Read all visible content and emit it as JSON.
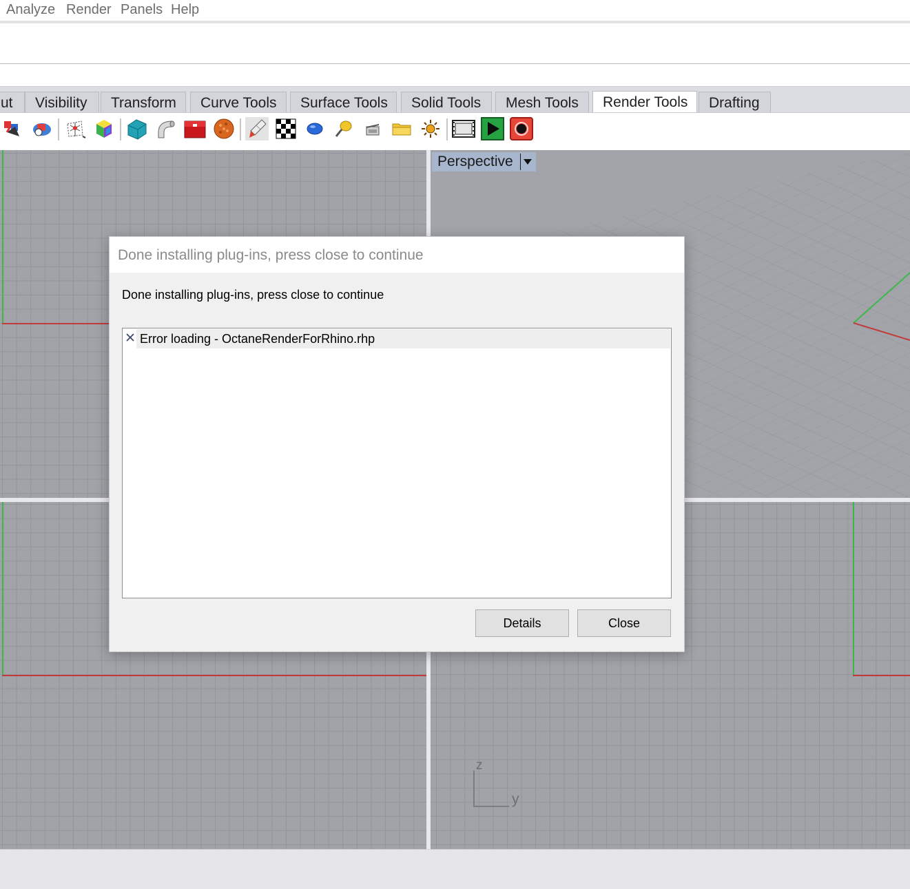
{
  "menu": {
    "items": [
      {
        "label": "Analyze"
      },
      {
        "label": "Render"
      },
      {
        "label": "Panels"
      },
      {
        "label": "Help"
      }
    ]
  },
  "tabs": [
    {
      "label": "ut"
    },
    {
      "label": "Visibility"
    },
    {
      "label": "Transform"
    },
    {
      "label": "Curve Tools"
    },
    {
      "label": "Surface Tools"
    },
    {
      "label": "Solid Tools"
    },
    {
      "label": "Mesh Tools"
    },
    {
      "label": "Render Tools",
      "active": true
    },
    {
      "label": "Drafting"
    }
  ],
  "toolbar": {
    "icons": [
      "render-tools-icon",
      "render-settings-icon",
      "lights-icon",
      "color-cube-icon",
      "environment-icon",
      "pipe-icon",
      "toolbox-icon",
      "texture-sphere-icon",
      "brush-icon",
      "checker-icon",
      "ellipse-icon",
      "spotlight-icon",
      "camera-icon",
      "folder-icon",
      "sun-icon",
      "film-icon",
      "play-icon",
      "record-icon"
    ]
  },
  "viewport": {
    "perspective_label": "Perspective",
    "axis_z": "z",
    "axis_y": "y"
  },
  "dialog": {
    "title": "Done installing plug-ins, press close to continue",
    "message": "Done installing plug-ins, press close to continue",
    "list_items": [
      {
        "status": "error",
        "text": "Error loading - OctaneRenderForRhino.rhp"
      }
    ],
    "details_label": "Details",
    "close_label": "Close"
  }
}
